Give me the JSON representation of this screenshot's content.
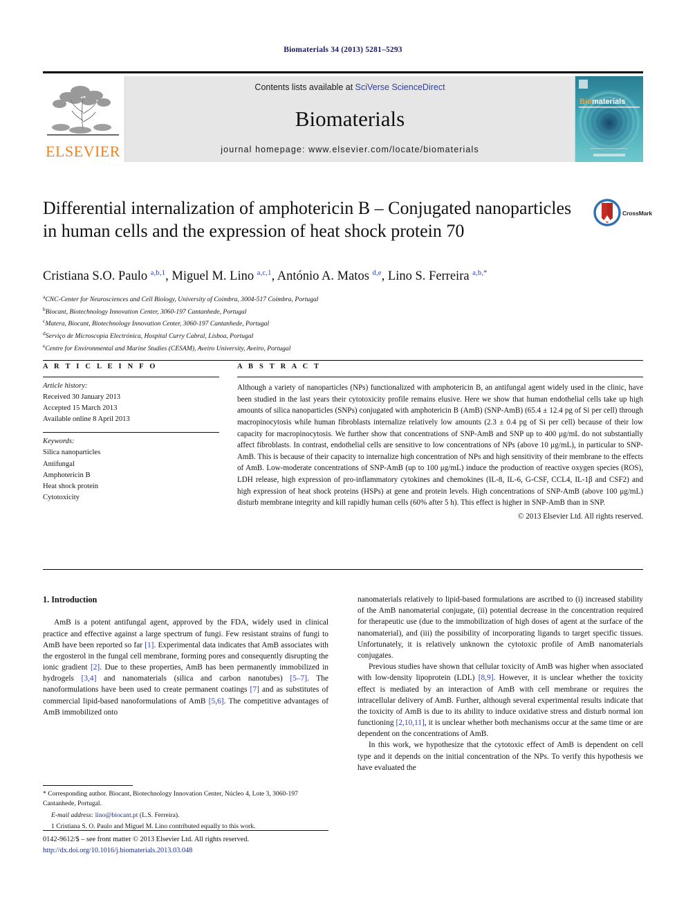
{
  "running_head": "Biomaterials 34 (2013) 5281–5293",
  "masthead": {
    "publisher_name": "ELSEVIER",
    "publisher_logo": "elsevier-tree-logo",
    "contents_prefix": "Contents lists available at ",
    "contents_link": "SciVerse ScienceDirect",
    "journal_name": "Biomaterials",
    "homepage_label": "journal homepage: www.elsevier.com/locate/biomaterials",
    "cover_brand_prefix": "Bio",
    "cover_brand_suffix": "materials"
  },
  "title": "Differential internalization of amphotericin B – Conjugated nanoparticles in human cells and the expression of heat shock protein 70",
  "crossmark_label": "CrossMark",
  "authors": [
    {
      "name": "Cristiana S.O. Paulo",
      "marks": "a,b,1",
      "sep": ", "
    },
    {
      "name": "Miguel M. Lino",
      "marks": "a,c,1",
      "sep": ", "
    },
    {
      "name": "António A. Matos",
      "marks": "d,e",
      "sep": ", "
    },
    {
      "name": "Lino S. Ferreira",
      "marks": "a,b,*",
      "sep": ""
    }
  ],
  "affiliations": [
    {
      "mark": "a",
      "text": "CNC-Center for Neurosciences and Cell Biology, University of Coimbra, 3004-517 Coimbra, Portugal"
    },
    {
      "mark": "b",
      "text": "Biocant, Biotechnology Innovation Center, 3060-197 Cantanhede, Portugal"
    },
    {
      "mark": "c",
      "text": "Matera, Biocant, Biotechnology Innovation Center, 3060-197 Cantanhede, Portugal"
    },
    {
      "mark": "d",
      "text": "Serviço de Microscopia Electrónica, Hospital Curry Cabral, Lisboa, Portugal"
    },
    {
      "mark": "e",
      "text": "Centre for Environmental and Marine Studies (CESAM), Aveiro University, Aveiro, Portugal"
    }
  ],
  "article_info": {
    "heading": "A R T I C L E  I N F O",
    "history_label": "Article history:",
    "history": [
      "Received 30 January 2013",
      "Accepted 15 March 2013",
      "Available online 8 April 2013"
    ],
    "keywords_label": "Keywords:",
    "keywords": [
      "Silica nanoparticles",
      "Antifungal",
      "Amphotericin B",
      "Heat shock protein",
      "Cytotoxicity"
    ]
  },
  "abstract": {
    "heading": "A B S T R A C T",
    "text": "Although a variety of nanoparticles (NPs) functionalized with amphotericin B, an antifungal agent widely used in the clinic, have been studied in the last years their cytotoxicity profile remains elusive. Here we show that human endothelial cells take up high amounts of silica nanoparticles (SNPs) conjugated with amphotericin B (AmB) (SNP-AmB) (65.4 ± 12.4 pg of Si per cell) through macropinocytosis while human fibroblasts internalize relatively low amounts (2.3 ± 0.4 pg of Si per cell) because of their low capacity for macropinocytosis. We further show that concentrations of SNP-AmB and SNP up to 400 μg/mL do not substantially affect fibroblasts. In contrast, endothelial cells are sensitive to low concentrations of NPs (above 10 μg/mL), in particular to SNP-AmB. This is because of their capacity to internalize high concentration of NPs and high sensitivity of their membrane to the effects of AmB. Low-moderate concentrations of SNP-AmB (up to 100 μg/mL) induce the production of reactive oxygen species (ROS), LDH release, high expression of pro-inflammatory cytokines and chemokines (IL-8, IL-6, G-CSF, CCL4, IL-1β and CSF2) and high expression of heat shock proteins (HSPs) at gene and protein levels. High concentrations of SNP-AmB (above 100 μg/mL) disturb membrane integrity and kill rapidly human cells (60% after 5 h). This effect is higher in SNP-AmB than in SNP.",
    "copyright": "© 2013 Elsevier Ltd. All rights reserved."
  },
  "introduction": {
    "heading": "1. Introduction",
    "left_paragraphs": [
      "AmB is a potent antifungal agent, approved by the FDA, widely used in clinical practice and effective against a large spectrum of fungi. Few resistant strains of fungi to AmB have been reported so far [1]. Experimental data indicates that AmB associates with the ergosterol in the fungal cell membrane, forming pores and consequently disrupting the ionic gradient [2]. Due to these properties, AmB has been permanently immobilized in hydrogels [3,4] and nanomaterials (silica and carbon nanotubes) [5–7]. The nanoformulations have been used to create permanent coatings [7] and as substitutes of commercial lipid-based nanoformulations of AmB [5,6]. The competitive advantages of AmB immobilized onto"
    ],
    "right_paragraphs": [
      "nanomaterials relatively to lipid-based formulations are ascribed to (i) increased stability of the AmB nanomaterial conjugate, (ii) potential decrease in the concentration required for therapeutic use (due to the immobilization of high doses of agent at the surface of the nanomaterial), and (iii) the possibility of incorporating ligands to target specific tissues. Unfortunately, it is relatively unknown the cytotoxic profile of AmB nanomaterials conjugates.",
      "Previous studies have shown that cellular toxicity of AmB was higher when associated with low-density lipoprotein (LDL) [8,9]. However, it is unclear whether the toxicity effect is mediated by an interaction of AmB with cell membrane or requires the intracellular delivery of AmB. Further, although several experimental results indicate that the toxicity of AmB is due to its ability to induce oxidative stress and disturb normal ion functioning [2,10,11], it is unclear whether both mechanisms occur at the same time or are dependent on the concentrations of AmB.",
      "In this work, we hypothesize that the cytotoxic effect of AmB is dependent on cell type and it depends on the initial concentration of the NPs. To verify this hypothesis we have evaluated the"
    ]
  },
  "footnotes": {
    "corresponding": "* Corresponding author. Biocant, Biotechnology Innovation Center, Núcleo 4, Lote 3, 3060-197 Cantanhede, Portugal.",
    "email_label": "E-mail address:",
    "email": "lino@biocant.pt",
    "email_owner": "(L.S. Ferreira).",
    "equal_contrib": "1 Cristiana S. O. Paulo and Miguel M. Lino contributed equally to this work."
  },
  "imprint": {
    "front_matter": "0142-9612/$ – see front matter © 2013 Elsevier Ltd. All rights reserved.",
    "doi": "http://dx.doi.org/10.1016/j.biomaterials.2013.03.048"
  },
  "colors": {
    "link_blue": "#2b3fae",
    "running_head_navy": "#17175c",
    "elsevier_orange": "#f08020",
    "cover_teal": "#1b6f86",
    "crossmark_blue": "#2f6fb5",
    "crossmark_red": "#b5281f"
  }
}
